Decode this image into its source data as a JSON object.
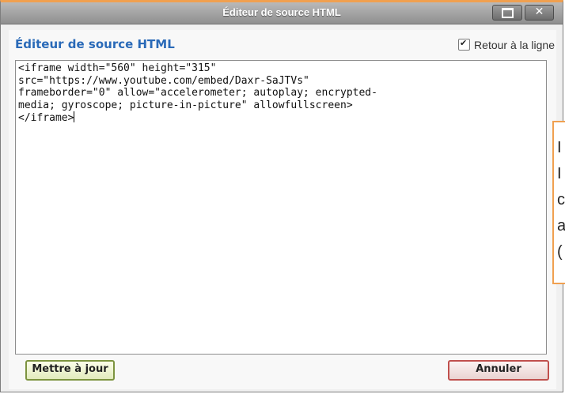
{
  "window": {
    "title": "Éditeur de source HTML"
  },
  "panel": {
    "heading": "Éditeur de source HTML",
    "wrap_label": "Retour à la ligne",
    "wrap_checked": true
  },
  "editor": {
    "content": "<iframe width=\"560\" height=\"315\"\nsrc=\"https://www.youtube.com/embed/Daxr-SaJTVs\"\nframeborder=\"0\" allow=\"accelerometer; autoplay; encrypted-\nmedia; gyroscope; picture-in-picture\" allowfullscreen>\n</iframe>"
  },
  "buttons": {
    "update_label": "Mettre à jour",
    "cancel_label": "Annuler"
  },
  "tooltip": {
    "lines": [
      "I",
      "I",
      "c",
      "a",
      "("
    ]
  },
  "colors": {
    "accent_orange": "#f0a050",
    "heading_blue": "#2a6ab8",
    "update_border": "#7d9440",
    "cancel_border": "#c0504d"
  }
}
